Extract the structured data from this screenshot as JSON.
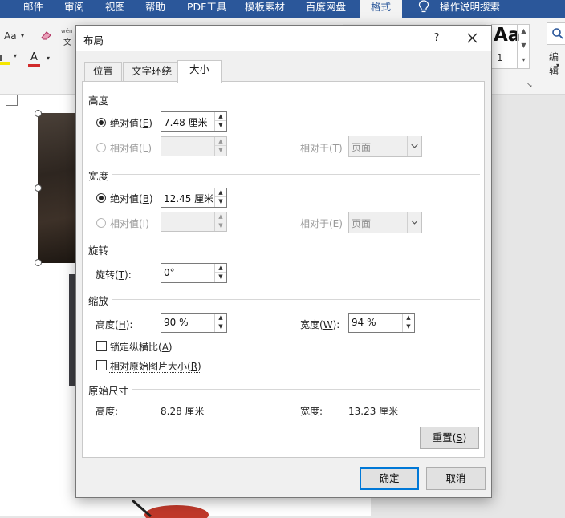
{
  "ribbon": {
    "tabs": [
      "邮件",
      "审阅",
      "视图",
      "帮助",
      "PDF工具",
      "模板素材",
      "百度网盘",
      "格式"
    ],
    "active_tab": "格式",
    "tell_me": "操作说明搜索",
    "font_aa": "Aa",
    "phonetic_top": "wén",
    "phonetic_bottom": "文",
    "style_preview": "Aa",
    "style_number": "1",
    "edit_label": "编辑"
  },
  "dialog": {
    "title": "布局",
    "help": "?",
    "tabs": [
      "位置",
      "文字环绕",
      "大小"
    ],
    "active_tab": "大小",
    "height_section": {
      "title": "高度",
      "absolute_label": "绝对值(",
      "absolute_key": "E",
      "absolute_value": "7.48 厘米",
      "relative_label": "相对值(L)",
      "relative_to_label": "相对于(T)",
      "relative_to_value": "页面"
    },
    "width_section": {
      "title": "宽度",
      "absolute_label": "绝对值(",
      "absolute_key": "B",
      "absolute_value": "12.45 厘米",
      "relative_label": "相对值(I)",
      "relative_to_label": "相对于(E)",
      "relative_to_value": "页面"
    },
    "rotate_section": {
      "title": "旋转",
      "label": "旋转(",
      "key": "T",
      "value": "0°"
    },
    "scale_section": {
      "title": "缩放",
      "height_label": "高度(",
      "height_key": "H",
      "height_value": "90 %",
      "width_label": "宽度(",
      "width_key": "W",
      "width_value": "94 %",
      "lock_ratio_label": "锁定纵横比(",
      "lock_ratio_key": "A",
      "relative_original_label": "相对原始图片大小(",
      "relative_original_key": "R"
    },
    "original_section": {
      "title": "原始尺寸",
      "height_label": "高度:",
      "height_value": "8.28 厘米",
      "width_label": "宽度:",
      "width_value": "13.23 厘米",
      "reset_label": "重置(",
      "reset_key": "S"
    },
    "ok_label": "确定",
    "cancel_label": "取消"
  },
  "colors": {
    "ribbon_blue": "#2b579a",
    "focus_blue": "#0078d7",
    "font_color_red": "#d12a2a"
  }
}
